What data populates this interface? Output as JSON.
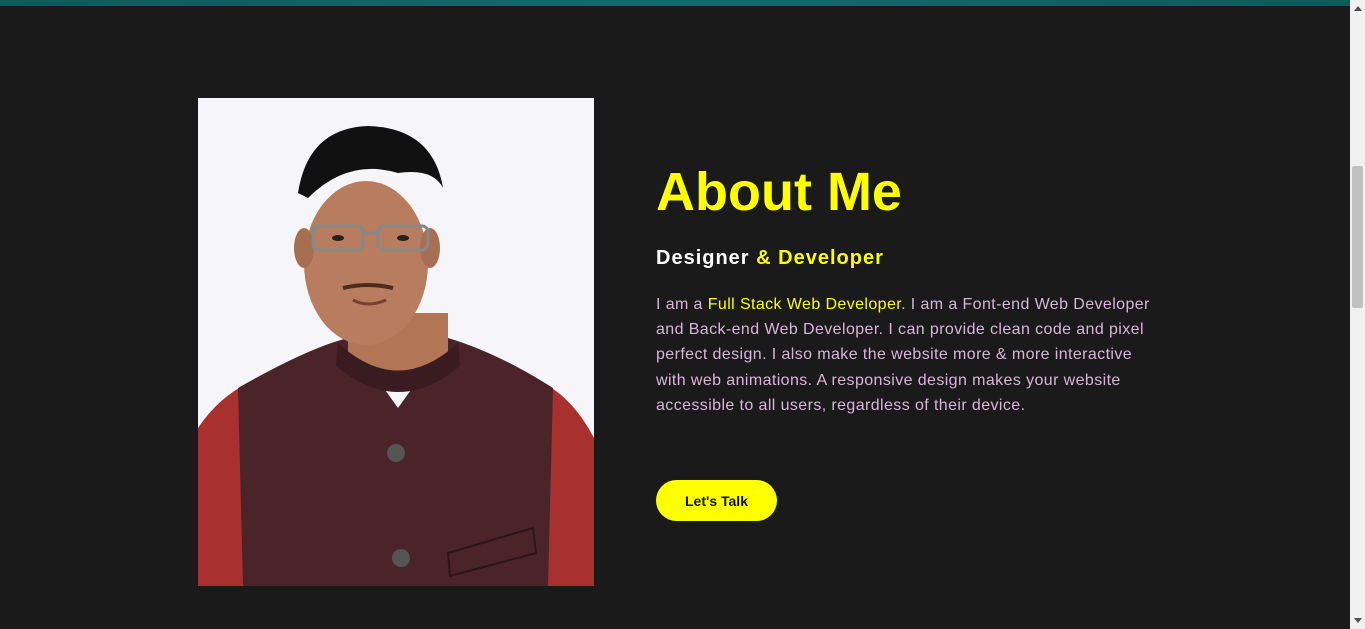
{
  "about": {
    "title": "About Me",
    "subtitle_part1": "Designer",
    "subtitle_part2": "& Developer",
    "desc_intro": "I am a ",
    "desc_highlight": "Full Stack Web Developer",
    "desc_rest": ". I am a Font-end Web Developer and Back-end Web Developer. I can provide clean code and pixel perfect design. I also make the website more & more interactive with web animations. A responsive design makes your website accessible to all users, regardless of their device.",
    "cta_label": "Let's Talk"
  },
  "colors": {
    "background": "#1a1a1a",
    "accent": "#ffff00",
    "text": "#d9b3dc",
    "photo_bg": "#f6f5fa"
  },
  "icons": {
    "photo": "portrait-photo"
  }
}
